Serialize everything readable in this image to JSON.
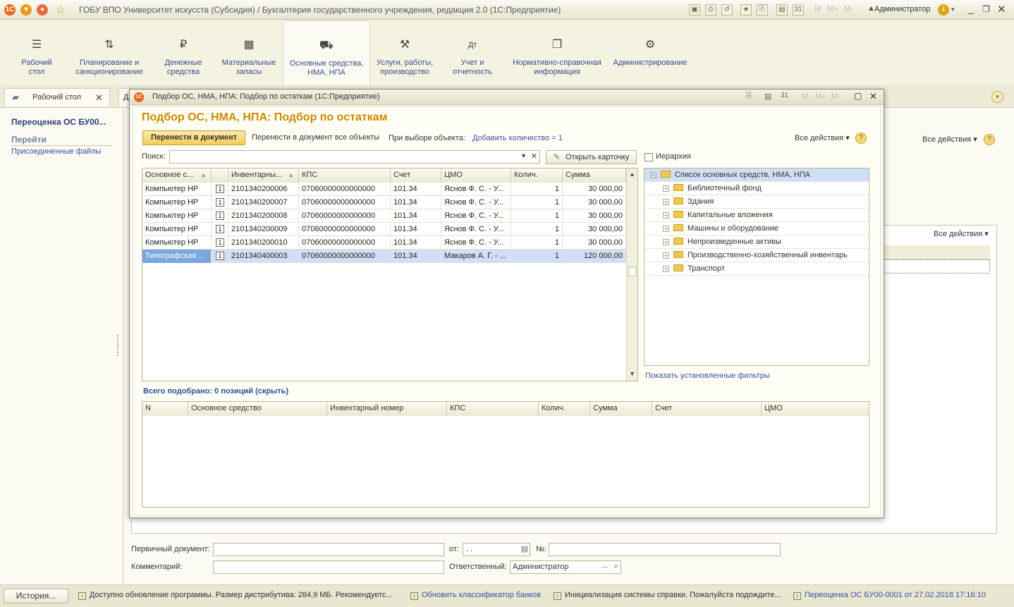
{
  "window": {
    "title": "ГОБУ ВПО Университет искусств (Субсидия) / Бухгалтерия государственного учреждения, редакция 2.0  (1С:Предприятие)",
    "user": "Администратор",
    "m_labels": [
      "M",
      "M+",
      "M-"
    ]
  },
  "sections": [
    {
      "label": "Рабочий стол",
      "icon": "☰"
    },
    {
      "label": "Планирование и санкционирование",
      "icon": "⇅"
    },
    {
      "label": "Денежные средства",
      "icon": "₽"
    },
    {
      "label": "Материальные запасы",
      "icon": "▦"
    },
    {
      "label": "Основные средства, НМА, НПА",
      "icon": "⛟"
    },
    {
      "label": "Услуги, работы, производство",
      "icon": "⚒"
    },
    {
      "label": "Учет и отчетность",
      "icon": "Дт"
    },
    {
      "label": "Нормативно-справочная информация",
      "icon": "❐"
    },
    {
      "label": "Администрирование",
      "icon": "⚙"
    }
  ],
  "tabs": {
    "desktop": "Рабочий стол",
    "close": "✕",
    "next": "Д"
  },
  "left_panel": {
    "title": "Переоценка ОС БУ00...",
    "section": "Перейти",
    "link": "Присоединенные файлы"
  },
  "doc": {
    "all_actions": "Все действия",
    "all_actions2": "Все действия",
    "primary_doc_label": "Первичный документ:",
    "from_label": "от:",
    "date_value": " .  .",
    "no_label": "№:",
    "comment_label": "Комментарий:",
    "responsible_label": "Ответственный:",
    "responsible_value": "Администратор"
  },
  "modal": {
    "window_title": "Подбор ОС, НМА, НПА: Подбор по остаткам  (1С:Предприятие)",
    "heading": "Подбор ОС, НМА, НПА: Подбор по остаткам",
    "btn_transfer": "Перенести в документ",
    "btn_transfer_all": "Перенести в документ все объекты",
    "on_select_label": "При выборе объекта:",
    "add_qty_link": "Добавить количество = 1",
    "all_actions": "Все действия",
    "search_label": "Поиск:",
    "search_value": "",
    "open_card": "Открыть карточку",
    "hierarchy_label": "Иерархия",
    "columns": [
      "Основное с...",
      "",
      "Инвентарны...",
      "КПС",
      "Счет",
      "ЦМО",
      "Колич.",
      "Сумма"
    ],
    "rows": [
      {
        "name": "Компьютер HP",
        "inv": "2101340200006",
        "kps": "07060000000000000",
        "acc": "101.34",
        "cmo": "Яснов Ф. С. - У...",
        "qty": "1",
        "sum": "30 000,00"
      },
      {
        "name": "Компьютер HP",
        "inv": "2101340200007",
        "kps": "07060000000000000",
        "acc": "101.34",
        "cmo": "Яснов Ф. С. - У...",
        "qty": "1",
        "sum": "30 000,00"
      },
      {
        "name": "Компьютер HP",
        "inv": "2101340200008",
        "kps": "07060000000000000",
        "acc": "101.34",
        "cmo": "Яснов Ф. С. - У...",
        "qty": "1",
        "sum": "30 000,00"
      },
      {
        "name": "Компьютер HP",
        "inv": "2101340200009",
        "kps": "07060000000000000",
        "acc": "101.34",
        "cmo": "Яснов Ф. С. - У...",
        "qty": "1",
        "sum": "30 000,00"
      },
      {
        "name": "Компьютер HP",
        "inv": "2101340200010",
        "kps": "07060000000000000",
        "acc": "101.34",
        "cmo": "Яснов Ф. С. - У...",
        "qty": "1",
        "sum": "30 000,00"
      },
      {
        "name": "Типографская ...",
        "inv": "2101340400003",
        "kps": "07060000000000000",
        "acc": "101.34",
        "cmo": "Макаров А. Г. - ...",
        "qty": "1",
        "sum": "120 000,00"
      }
    ],
    "row_marker": "1",
    "tree_root": "Список основных средств, НМА, НПА",
    "tree_items": [
      "Библиотечный фонд",
      "Здания",
      "Капитальные вложения",
      "Машины и оборудование",
      "Непроизведенные активы",
      "Производственно-хозяйственный инвентарь",
      "Транспорт"
    ],
    "show_filters": "Показать установленные фильтры",
    "selected_summary": "Всего подобрано: 0 позиций (скрыть)",
    "selected_columns": [
      "N",
      "Основное средство",
      "Инвентарный номер",
      "КПС",
      "Колич.",
      "Сумма",
      "Счет",
      "ЦМО"
    ]
  },
  "status": {
    "history_btn": "История...",
    "msg1": "Доступно обновление программы. Размер дистрибутива: 284,9 МБ. Рекомендуетс...",
    "msg2": "Обновить классификатор банков",
    "msg3": "Инициализация системы справки. Пожалуйста подождите...",
    "msg4": "Переоценка ОС БУ00-0001 от 27.02.2018 17:16:10"
  },
  "colors": {
    "accent": "#c98a00",
    "link": "#3a4fa0",
    "selection": "#cfe0f5"
  }
}
